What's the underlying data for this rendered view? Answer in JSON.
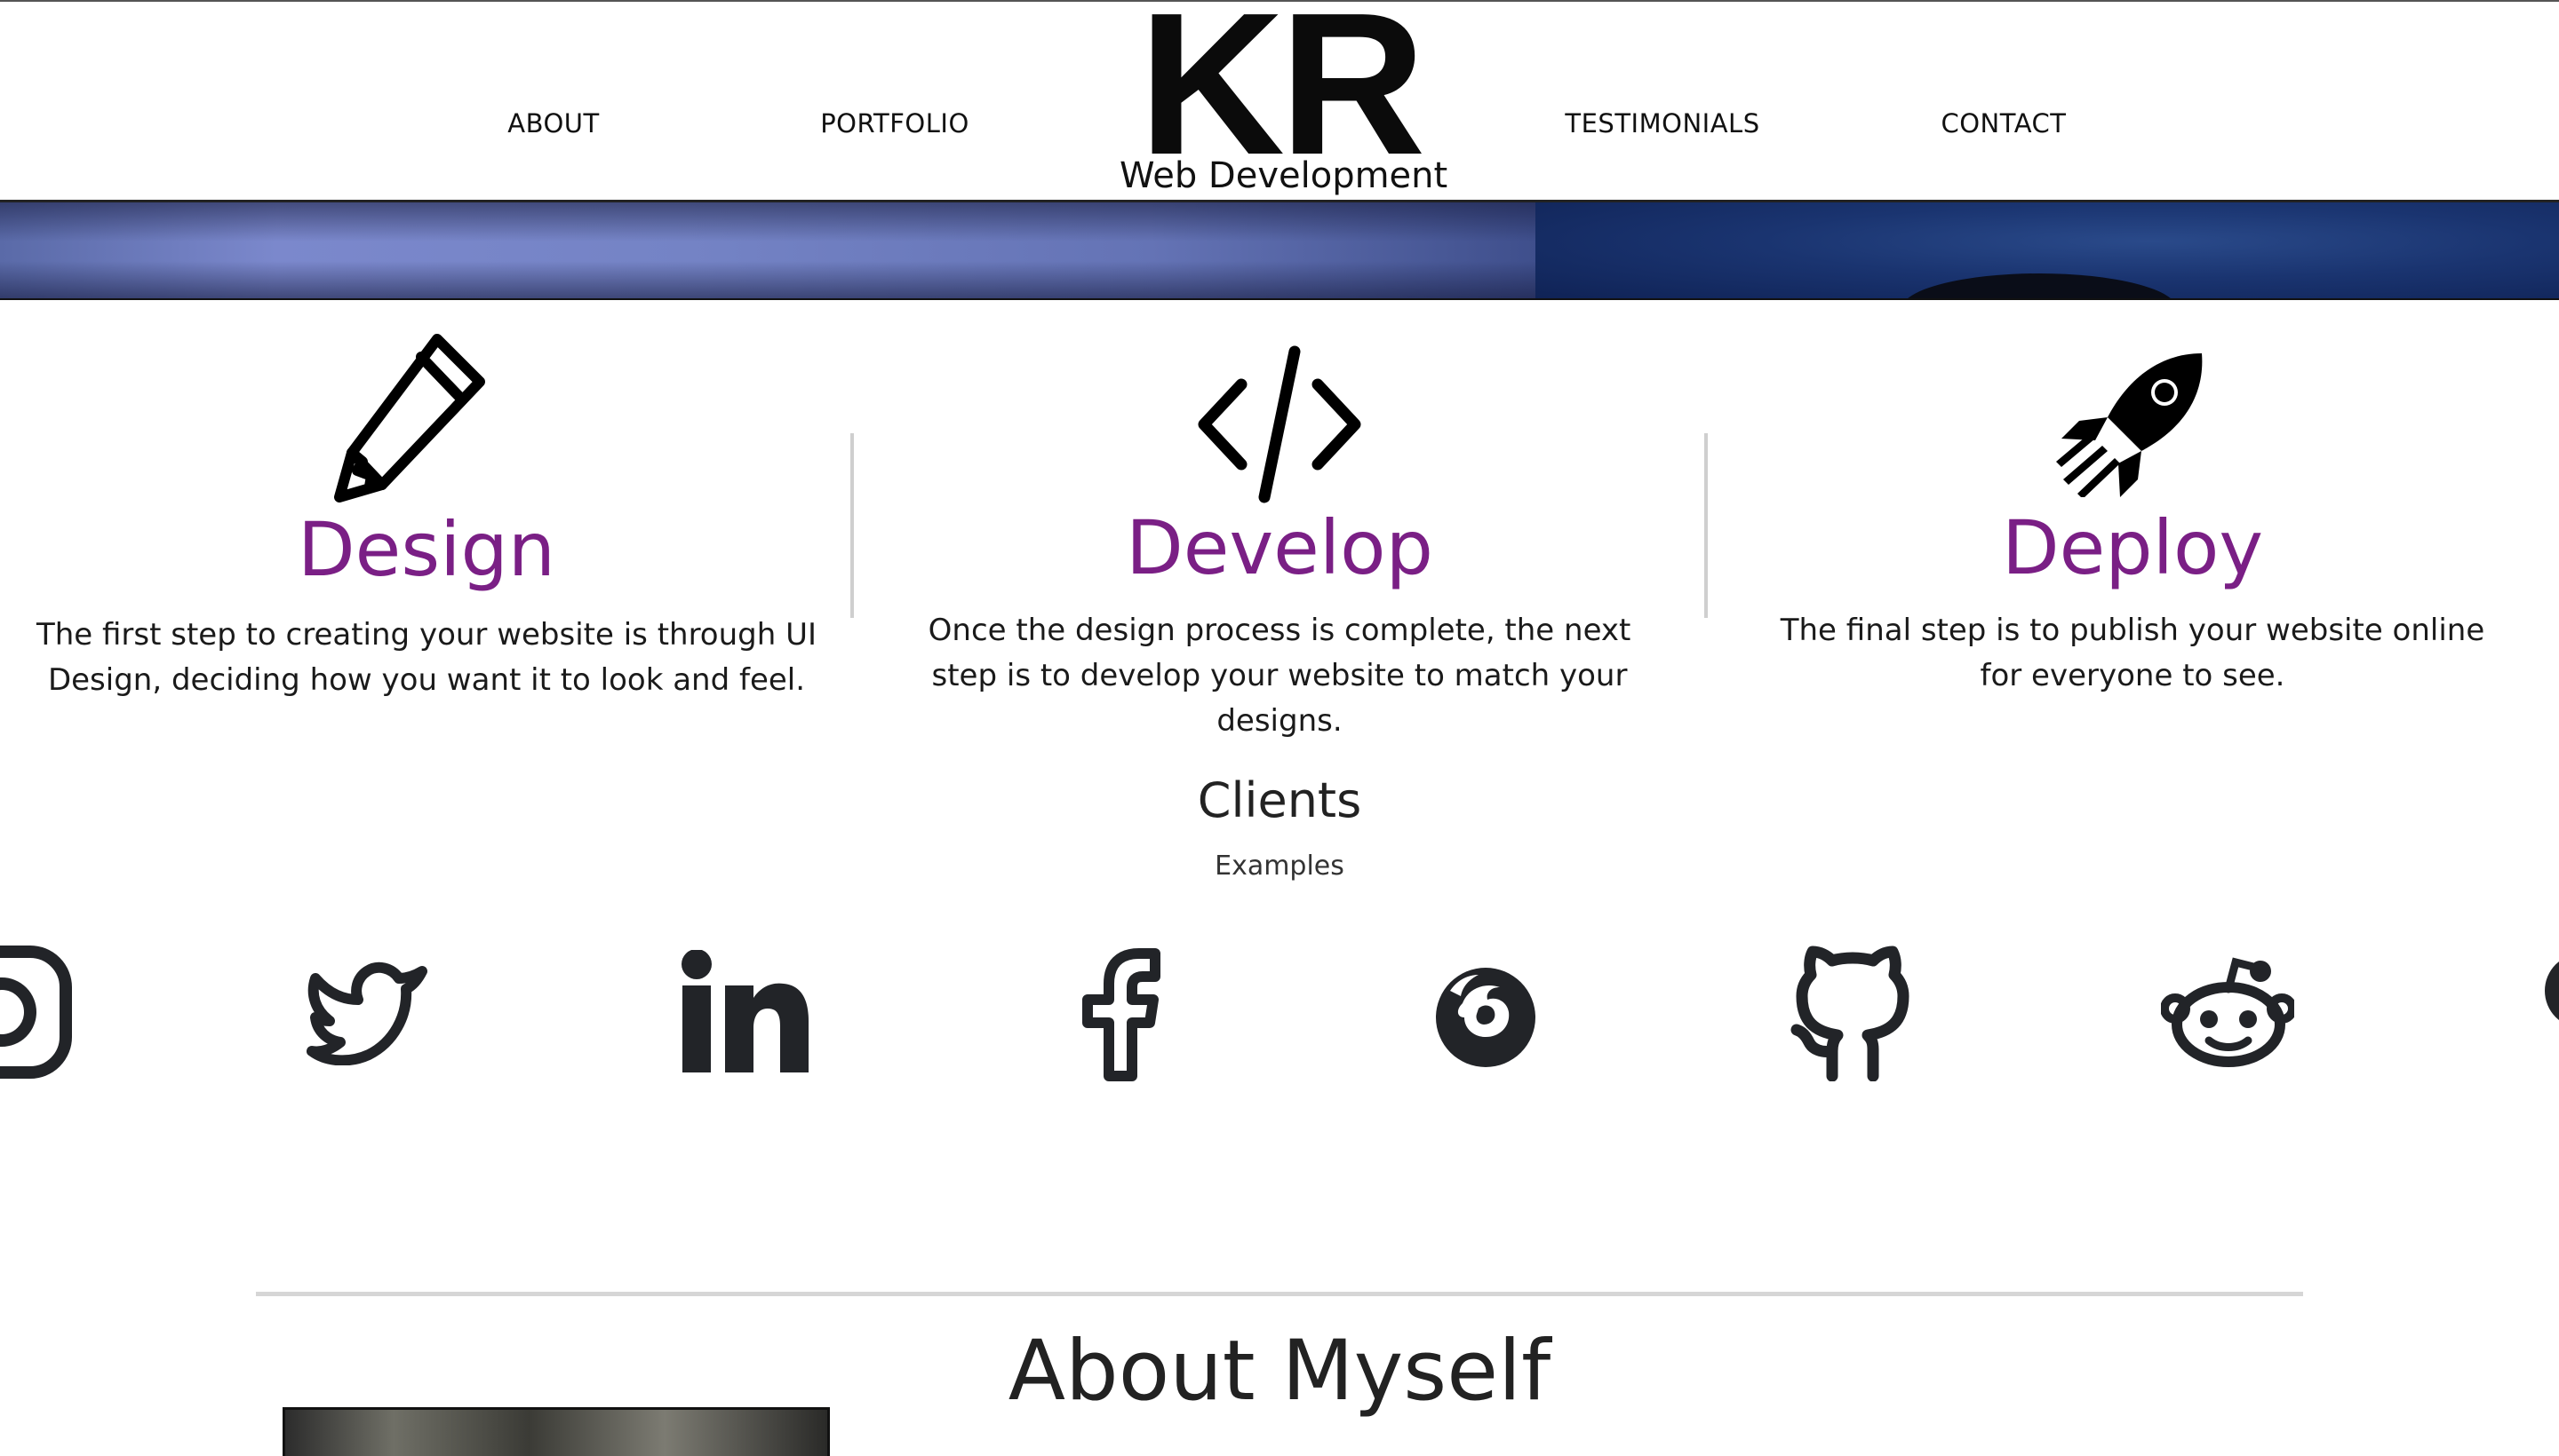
{
  "nav": {
    "about": "ABOUT",
    "portfolio": "PORTFOLIO",
    "testimonials": "TESTIMONIALS",
    "contact": "CONTACT"
  },
  "logo": {
    "mark": "KR",
    "subtitle": "Web Development"
  },
  "services": [
    {
      "title": "Design",
      "description": "The first step to creating your website is through UI Design, deciding how you want it to look and feel.",
      "icon": "pencil-icon"
    },
    {
      "title": "Develop",
      "description": "Once the design process is complete, the next step is to develop your website to match your designs.",
      "icon": "code-icon"
    },
    {
      "title": "Deploy",
      "description": "The final step is to publish your website online for everyone to see.",
      "icon": "rocket-icon"
    }
  ],
  "clients": {
    "title": "Clients",
    "subtitle": "Examples",
    "logos": [
      "instagram-icon",
      "twitter-icon",
      "linkedin-icon",
      "facebook-icon",
      "firefox-icon",
      "github-icon",
      "reddit-icon",
      "partial-logo-icon"
    ]
  },
  "about": {
    "title": "About Myself"
  },
  "colors": {
    "accent": "#7a1f85",
    "text": "#222222",
    "icon": "#222428"
  }
}
